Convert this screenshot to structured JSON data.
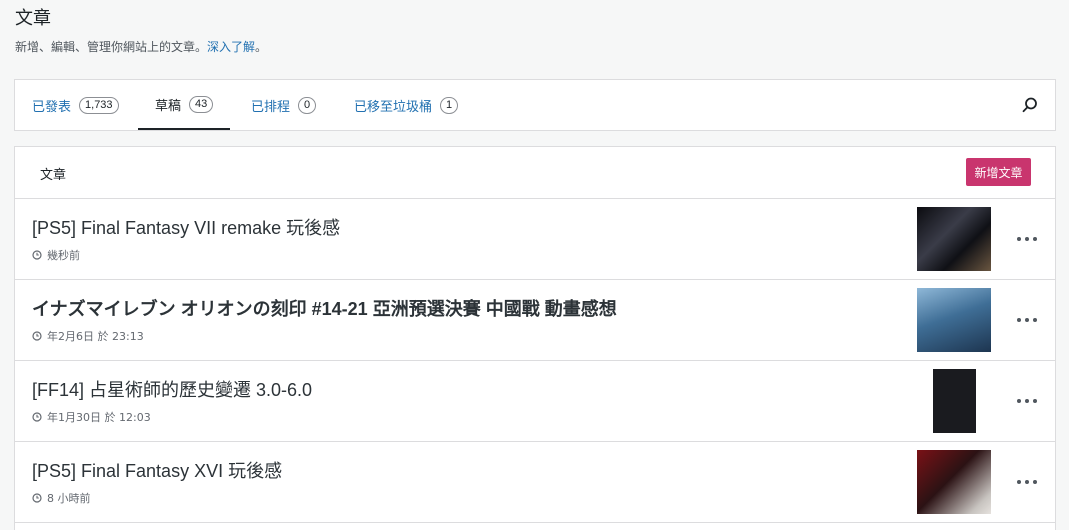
{
  "header": {
    "title": "文章",
    "subtitle": "新增、編輯、管理你網站上的文章。",
    "learn_more": "深入了解",
    "subtitle_end": "。"
  },
  "tabs": [
    {
      "label": "已發表",
      "count": "1,733",
      "active": false
    },
    {
      "label": "草稿",
      "count": "43",
      "active": true
    },
    {
      "label": "已排程",
      "count": "0",
      "active": false
    },
    {
      "label": "已移至垃圾桶",
      "count": "1",
      "active": false
    }
  ],
  "search": {
    "icon": "search-icon"
  },
  "list": {
    "header_title": "文章",
    "new_post_label": "新增文章",
    "posts": [
      {
        "title": "[PS5] Final Fantasy VII remake 玩後感",
        "time": "幾秒前"
      },
      {
        "title": "イナズマイレブン オリオンの刻印 #14-21 亞洲預選決賽 中國戰 動畫感想",
        "time": "年2月6日 於 23:13"
      },
      {
        "title": "[FF14] 占星術師的歷史變遷 3.0-6.0",
        "time": "年1月30日 於 12:03"
      },
      {
        "title": "[PS5] Final Fantasy XVI 玩後感",
        "time": "8 小時前"
      }
    ]
  },
  "colors": {
    "accent": "#2271b1",
    "primary_button": "#c9356e",
    "background": "#f6f7f7"
  }
}
